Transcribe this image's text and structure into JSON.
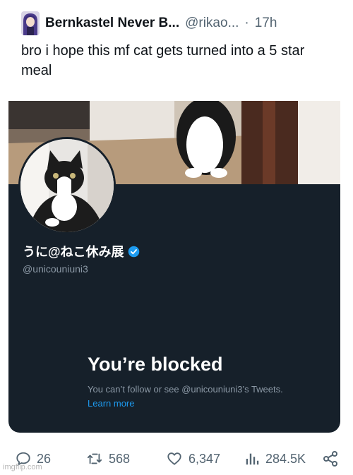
{
  "tweet": {
    "author_name": "Bernkastel Never B...",
    "author_handle": "@rikao...",
    "time_separator": "·",
    "time": "17h",
    "text": "bro i hope this mf cat gets turned into a 5 star meal"
  },
  "blocked_card": {
    "display_name": "うに@ねこ休み展",
    "handle": "@unicouniuni3",
    "title": "You’re blocked",
    "description": "You can’t follow or see @unicouniuni3’s Tweets.",
    "learn_more": "Learn more"
  },
  "actions": {
    "replies": "26",
    "retweets": "568",
    "likes": "6,347",
    "views": "284.5K"
  },
  "watermark": "imgflip.com",
  "colors": {
    "card_bg": "#16202a",
    "verified": "#1d9bf0",
    "link": "#1d9bf0",
    "muted": "#8b98a5"
  },
  "icons": [
    "reply-icon",
    "retweet-icon",
    "like-icon",
    "views-icon",
    "share-icon",
    "verified-badge-icon"
  ]
}
